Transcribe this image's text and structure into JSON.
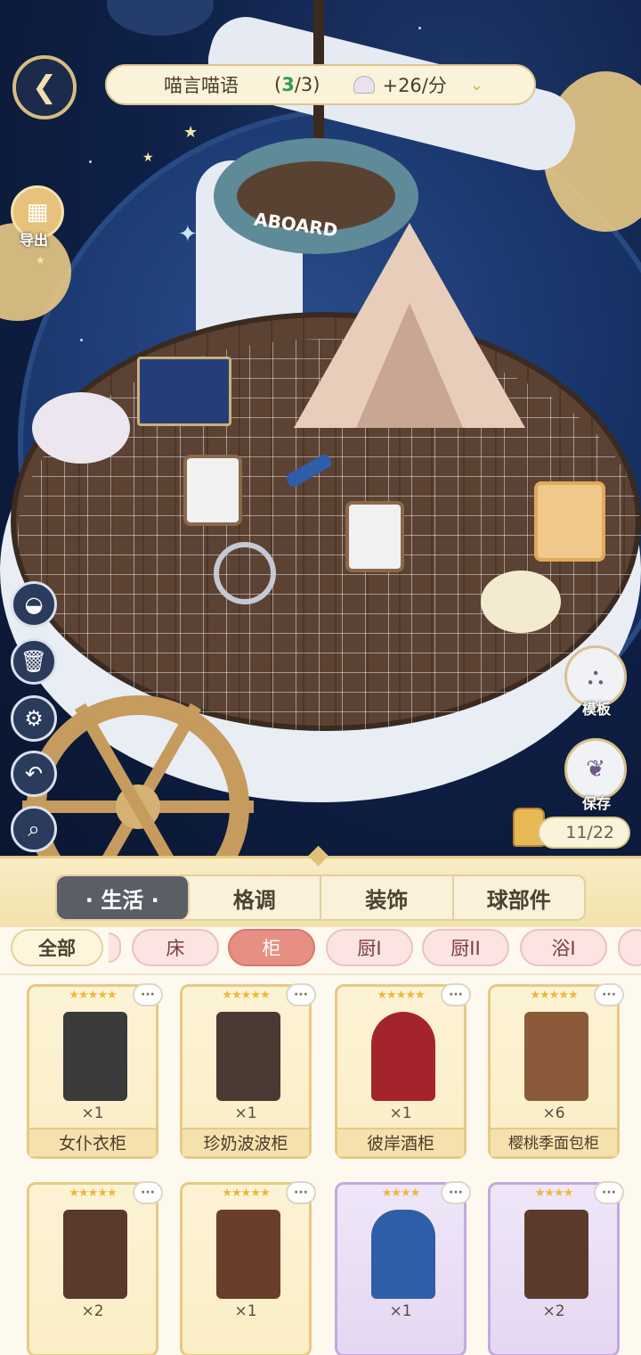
{
  "header": {
    "title": "喵言喵语",
    "progress_open": "(",
    "progress_current": "3",
    "progress_total": "/3)",
    "rate": "+26/分"
  },
  "left_tools": {
    "export_label": "导出"
  },
  "right_tools": {
    "template_label": "模板",
    "save_label": "保存",
    "capacity": "11/22"
  },
  "scene": {
    "ring_text": "ABOARD"
  },
  "main_tabs": [
    {
      "label": "· 生活 ·",
      "active": true
    },
    {
      "label": "格调",
      "active": false
    },
    {
      "label": "装饰",
      "active": false
    },
    {
      "label": "球部件",
      "active": false
    }
  ],
  "filters": [
    {
      "label": "全部"
    },
    {
      "label": "床"
    },
    {
      "label": "柜"
    },
    {
      "label": "厨I"
    },
    {
      "label": "厨II"
    },
    {
      "label": "浴I"
    }
  ],
  "items": [
    {
      "name": "女仆衣柜",
      "qty": "×1",
      "stars": "★★★★★",
      "rarity": "gold",
      "art_color": "#3b3b3b"
    },
    {
      "name": "珍奶波波柜",
      "qty": "×1",
      "stars": "★★★★★",
      "rarity": "gold",
      "art_color": "#4a3a33"
    },
    {
      "name": "彼岸酒柜",
      "qty": "×1",
      "stars": "★★★★★",
      "rarity": "gold",
      "art_color": "#a4242c"
    },
    {
      "name": "樱桃季面包柜",
      "qty": "×6",
      "stars": "★★★★★",
      "rarity": "gold",
      "art_color": "#8b5a3a"
    },
    {
      "name": "",
      "qty": "×2",
      "stars": "★★★★★",
      "rarity": "gold",
      "art_color": "#5a3a2a"
    },
    {
      "name": "",
      "qty": "×1",
      "stars": "★★★★★",
      "rarity": "gold",
      "art_color": "#6a3e2a"
    },
    {
      "name": "",
      "qty": "×1",
      "stars": "★★★★",
      "rarity": "purple",
      "art_color": "#2f5ea8"
    },
    {
      "name": "",
      "qty": "×2",
      "stars": "★★★★",
      "rarity": "purple",
      "art_color": "#5b3b2c"
    }
  ]
}
